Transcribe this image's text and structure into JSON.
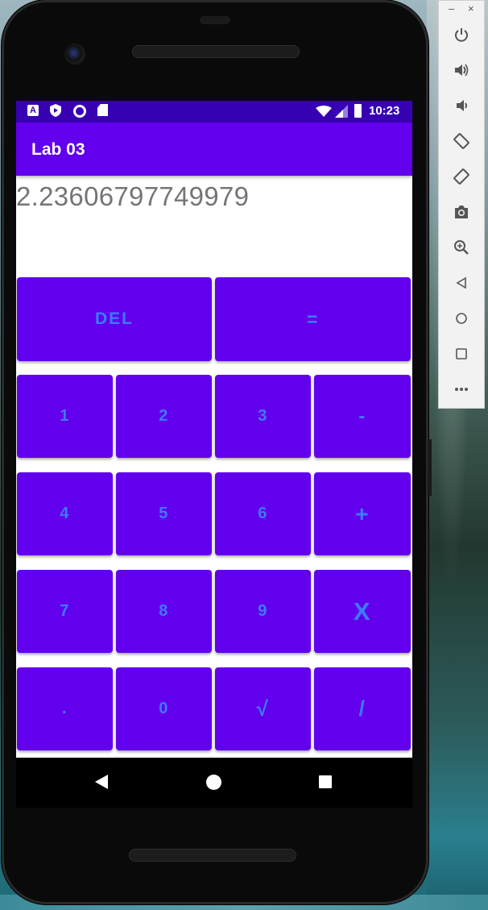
{
  "app": {
    "title": "Lab 03",
    "display_value": "2.23606797749979"
  },
  "status_bar": {
    "time": "10:23",
    "icons": [
      "a-notification-icon",
      "play-protect-icon",
      "circle-icon",
      "sd-card-icon",
      "wifi-icon",
      "signal-icon",
      "battery-icon"
    ]
  },
  "keypad": {
    "row0": [
      "DEL",
      "="
    ],
    "row1": [
      "1",
      "2",
      "3",
      "-"
    ],
    "row2": [
      "4",
      "5",
      "6",
      "+"
    ],
    "row3": [
      "7",
      "8",
      "9",
      "X"
    ],
    "row4": [
      ".",
      "0",
      "√",
      "/"
    ]
  },
  "nav_bar": {
    "buttons": [
      "back",
      "home",
      "overview"
    ]
  },
  "emulator_toolbar": {
    "minimize": "–",
    "close": "×",
    "tools": [
      "power",
      "volume-up",
      "volume-down",
      "rotate-left",
      "rotate-right",
      "screenshot",
      "zoom",
      "back",
      "home",
      "overview",
      "more"
    ]
  },
  "colors": {
    "primary": "#6200ee",
    "primary_dark": "#3700b3",
    "key_text": "#3d7bff",
    "display_text": "#757575"
  }
}
